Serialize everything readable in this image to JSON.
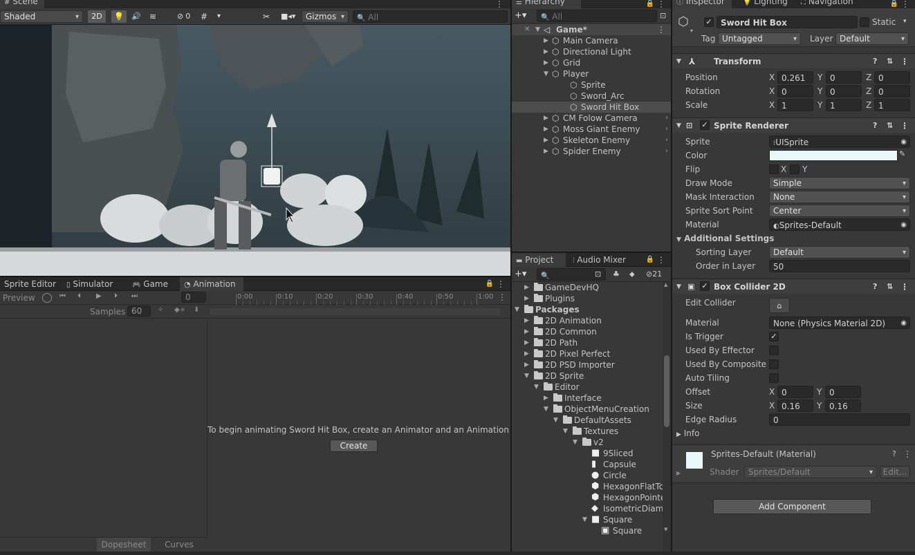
{
  "scene": {
    "tab": "Scene",
    "shading": "Shaded",
    "mode_2d": "2D",
    "hidden_count": "0",
    "gizmos": "Gizmos",
    "search_placeholder": "All"
  },
  "hierarchy": {
    "tab": "Hierarchy",
    "search_placeholder": "All",
    "items": [
      {
        "label": "Game*",
        "depth": 0,
        "type": "scene"
      },
      {
        "label": "Main Camera",
        "depth": 1
      },
      {
        "label": "Directional Light",
        "depth": 1
      },
      {
        "label": "Grid",
        "depth": 1
      },
      {
        "label": "Player",
        "depth": 1
      },
      {
        "label": "Sprite",
        "depth": 2
      },
      {
        "label": "Sword_Arc",
        "depth": 2
      },
      {
        "label": "Sword Hit Box",
        "depth": 2,
        "selected": true
      },
      {
        "label": "CM Folow Camera",
        "depth": 1
      },
      {
        "label": "Moss Giant Enemy",
        "depth": 1
      },
      {
        "label": "Skeleton Enemy",
        "depth": 1
      },
      {
        "label": "Spider Enemy",
        "depth": 1
      }
    ]
  },
  "project": {
    "tab": "Project",
    "tab2": "Audio Mixer",
    "hidden_count": "21",
    "items": [
      {
        "label": "GameDevHQ",
        "depth": 1,
        "kind": "folder",
        "open": false
      },
      {
        "label": "Plugins",
        "depth": 1,
        "kind": "folder",
        "open": false
      },
      {
        "label": "Packages",
        "depth": 0,
        "kind": "folder",
        "open": true,
        "bold": true
      },
      {
        "label": "2D Animation",
        "depth": 1,
        "kind": "folder",
        "open": false
      },
      {
        "label": "2D Common",
        "depth": 1,
        "kind": "folder",
        "open": false
      },
      {
        "label": "2D Path",
        "depth": 1,
        "kind": "folder",
        "open": false
      },
      {
        "label": "2D Pixel Perfect",
        "depth": 1,
        "kind": "folder",
        "open": false
      },
      {
        "label": "2D PSD Importer",
        "depth": 1,
        "kind": "folder",
        "open": false
      },
      {
        "label": "2D Sprite",
        "depth": 1,
        "kind": "folder",
        "open": true
      },
      {
        "label": "Editor",
        "depth": 2,
        "kind": "folder",
        "open": true
      },
      {
        "label": "Interface",
        "depth": 3,
        "kind": "folder",
        "open": false
      },
      {
        "label": "ObjectMenuCreation",
        "depth": 3,
        "kind": "folder",
        "open": true
      },
      {
        "label": "DefaultAssets",
        "depth": 4,
        "kind": "folder",
        "open": true
      },
      {
        "label": "Textures",
        "depth": 5,
        "kind": "folder",
        "open": true
      },
      {
        "label": "v2",
        "depth": 6,
        "kind": "folder",
        "open": true
      },
      {
        "label": "9Sliced",
        "depth": 7,
        "kind": "sq"
      },
      {
        "label": "Capsule",
        "depth": 7,
        "kind": "cap"
      },
      {
        "label": "Circle",
        "depth": 7,
        "kind": "circ"
      },
      {
        "label": "HexagonFlatTo",
        "depth": 7,
        "kind": "hex"
      },
      {
        "label": "HexagonPointe",
        "depth": 7,
        "kind": "hex"
      },
      {
        "label": "IsometricDiam",
        "depth": 7,
        "kind": "dia"
      },
      {
        "label": "Square",
        "depth": 7,
        "kind": "sq",
        "open": true
      },
      {
        "label": "Square",
        "depth": 8,
        "kind": "sprite"
      }
    ]
  },
  "bottom_tabs": {
    "sprite_editor": "Sprite Editor",
    "simulator": "Simulator",
    "game": "Game",
    "animation": "Animation"
  },
  "animation": {
    "preview": "Preview",
    "frame": "0",
    "samples_label": "Samples",
    "samples": "60",
    "ticks": [
      "0:00",
      "0:10",
      "0:20",
      "0:30",
      "0:40",
      "0:50",
      "1:00"
    ],
    "message": "To begin animating Sword Hit Box, create an Animator and an Animation Clip",
    "create": "Create",
    "dopesheet": "Dopesheet",
    "curves": "Curves"
  },
  "inspector": {
    "tab": "Inspector",
    "tab_lighting": "Lighting",
    "tab_navigation": "Navigation",
    "object_name": "Sword Hit Box",
    "static_label": "Static",
    "tag_label": "Tag",
    "tag": "Untagged",
    "layer_label": "Layer",
    "layer": "Default",
    "transform": {
      "title": "Transform",
      "position_label": "Position",
      "rotation_label": "Rotation",
      "scale_label": "Scale",
      "position": [
        "0.261",
        "0",
        "0"
      ],
      "rotation": [
        "0",
        "0",
        "0"
      ],
      "scale": [
        "1",
        "1",
        "1"
      ]
    },
    "sprite_renderer": {
      "title": "Sprite Renderer",
      "sprite_label": "Sprite",
      "sprite": "UISprite",
      "color_label": "Color",
      "color": "#e9f9fb",
      "flip_label": "Flip",
      "flip_x": "X",
      "flip_y": "Y",
      "draw_mode_label": "Draw Mode",
      "draw_mode": "Simple",
      "mask_label": "Mask Interaction",
      "mask": "None",
      "sort_point_label": "Sprite Sort Point",
      "sort_point": "Center",
      "material_label": "Material",
      "material": "Sprites-Default",
      "additional": "Additional Settings",
      "sorting_layer_label": "Sorting Layer",
      "sorting_layer": "Default",
      "order_label": "Order in Layer",
      "order": "50"
    },
    "box_collider": {
      "title": "Box Collider 2D",
      "edit_label": "Edit Collider",
      "material_label": "Material",
      "material": "None (Physics Material 2D)",
      "trigger_label": "Is Trigger",
      "effector_label": "Used By Effector",
      "composite_label": "Used By Composite",
      "tiling_label": "Auto Tiling",
      "offset_label": "Offset",
      "offset": [
        "0",
        "0"
      ],
      "size_label": "Size",
      "size": [
        "0.16",
        "0.16"
      ],
      "edge_label": "Edge Radius",
      "edge": "0",
      "info_label": "Info"
    },
    "material_block": {
      "title": "Sprites-Default (Material)",
      "shader_label": "Shader",
      "shader": "Sprites/Default",
      "edit": "Edit..."
    },
    "add_component": "Add Component"
  },
  "colors": {
    "accent": "#4c7fff",
    "selection": "#2c5d87",
    "panel": "#383838"
  }
}
